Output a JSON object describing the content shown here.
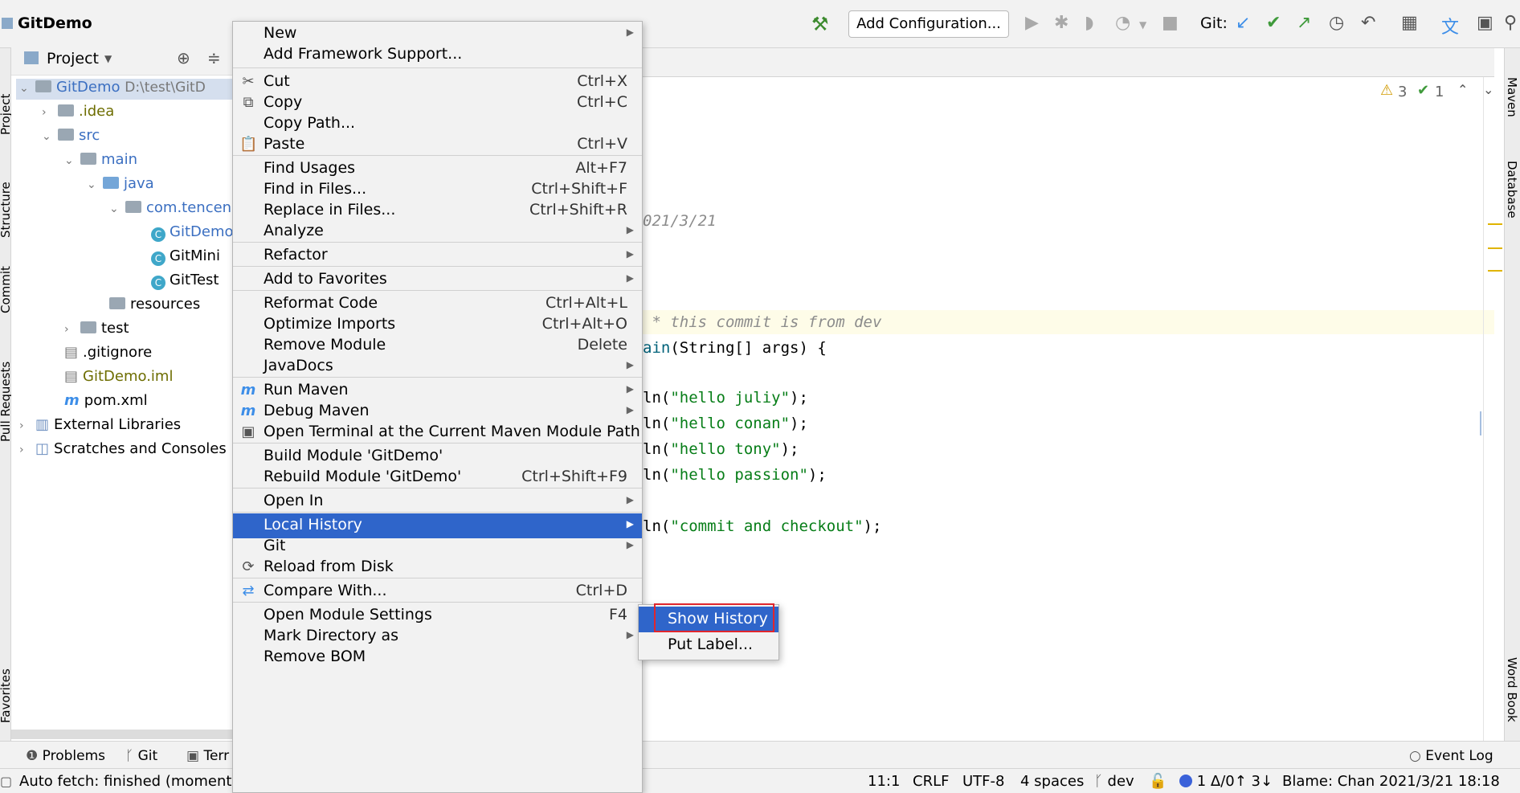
{
  "toolbar": {
    "title": "GitDemo",
    "add_config": "Add Configuration...",
    "git_label": "Git:"
  },
  "project_panel": {
    "header": "Project",
    "tree": [
      {
        "label": "GitDemo",
        "suffix": "D:\\test\\GitD"
      },
      {
        "label": ".idea"
      },
      {
        "label": "src"
      },
      {
        "label": "main"
      },
      {
        "label": "java"
      },
      {
        "label": "com.tencen"
      },
      {
        "label": "GitDemo"
      },
      {
        "label": "GitMini"
      },
      {
        "label": "GitTest"
      },
      {
        "label": "resources"
      },
      {
        "label": "test"
      },
      {
        "label": ".gitignore"
      },
      {
        "label": "GitDemo.iml"
      },
      {
        "label": "pom.xml"
      },
      {
        "label": "External Libraries"
      },
      {
        "label": "Scratches and Consoles"
      }
    ]
  },
  "left_strip": [
    "Project",
    "Structure",
    "Commit",
    "Pull Requests",
    "Favorites"
  ],
  "right_strip": [
    "Maven",
    "Database",
    "Word Book"
  ],
  "editor": {
    "inspections": {
      "warnings": "3",
      "checks": "1"
    },
    "lines": [
      {
        "text": "021/3/21",
        "type": "comment"
      },
      {
        "text": " * this commit is from dev",
        "type": "comment"
      },
      {
        "method": "ain",
        "rest": "(String[] args) {"
      },
      {
        "pre": "ln(",
        "str": "\"hello juliy\"",
        "post": ");"
      },
      {
        "pre": "ln(",
        "str": "\"hello conan\"",
        "post": ");"
      },
      {
        "pre": "ln(",
        "str": "\"hello tony\"",
        "post": ");"
      },
      {
        "pre": "ln(",
        "str": "\"hello passion\"",
        "post": ");"
      },
      {
        "pre": "ln(",
        "str": "\"commit and checkout\"",
        "post": ");"
      }
    ]
  },
  "context_menu": {
    "items": [
      {
        "label": "New",
        "submenu": true
      },
      {
        "label": "Add Framework Support..."
      },
      {
        "label": "Cut",
        "shortcut": "Ctrl+X",
        "icon": "scissors-icon"
      },
      {
        "label": "Copy",
        "shortcut": "Ctrl+C",
        "icon": "copy-icon"
      },
      {
        "label": "Copy Path..."
      },
      {
        "label": "Paste",
        "shortcut": "Ctrl+V",
        "icon": "paste-icon"
      },
      {
        "label": "Find Usages",
        "shortcut": "Alt+F7"
      },
      {
        "label": "Find in Files...",
        "shortcut": "Ctrl+Shift+F"
      },
      {
        "label": "Replace in Files...",
        "shortcut": "Ctrl+Shift+R"
      },
      {
        "label": "Analyze",
        "submenu": true
      },
      {
        "label": "Refactor",
        "submenu": true
      },
      {
        "label": "Add to Favorites",
        "submenu": true
      },
      {
        "label": "Reformat Code",
        "shortcut": "Ctrl+Alt+L"
      },
      {
        "label": "Optimize Imports",
        "shortcut": "Ctrl+Alt+O"
      },
      {
        "label": "Remove Module",
        "shortcut": "Delete"
      },
      {
        "label": "JavaDocs",
        "submenu": true
      },
      {
        "label": "Run Maven",
        "submenu": true,
        "icon": "maven-icon"
      },
      {
        "label": "Debug Maven",
        "submenu": true,
        "icon": "maven-icon"
      },
      {
        "label": "Open Terminal at the Current Maven Module Path",
        "icon": "maven-terminal-icon"
      },
      {
        "label": "Build Module 'GitDemo'"
      },
      {
        "label": "Rebuild Module 'GitDemo'",
        "shortcut": "Ctrl+Shift+F9"
      },
      {
        "label": "Open In",
        "submenu": true
      },
      {
        "label": "Local History",
        "submenu": true,
        "selected": true
      },
      {
        "label": "Git",
        "submenu": true
      },
      {
        "label": "Reload from Disk",
        "icon": "reload-icon"
      },
      {
        "label": "Compare With...",
        "shortcut": "Ctrl+D",
        "icon": "compare-icon"
      },
      {
        "label": "Open Module Settings",
        "shortcut": "F4"
      },
      {
        "label": "Mark Directory as",
        "submenu": true
      },
      {
        "label": "Remove BOM"
      }
    ]
  },
  "submenu": {
    "items": [
      {
        "label": "Show History",
        "selected": true
      },
      {
        "label": "Put Label..."
      }
    ]
  },
  "bottom_tools": {
    "problems": "Problems",
    "git": "Git",
    "terminal": "Terr",
    "event_log": "Event Log"
  },
  "status_bar": {
    "message": "Auto fetch: finished (moments",
    "position": "11:1",
    "line_sep": "CRLF",
    "encoding": "UTF-8",
    "indent": "4 spaces",
    "branch": "dev",
    "changes": "1 Δ/0↑ 3↓",
    "blame": "Blame: Chan 2021/3/21 18:18"
  }
}
